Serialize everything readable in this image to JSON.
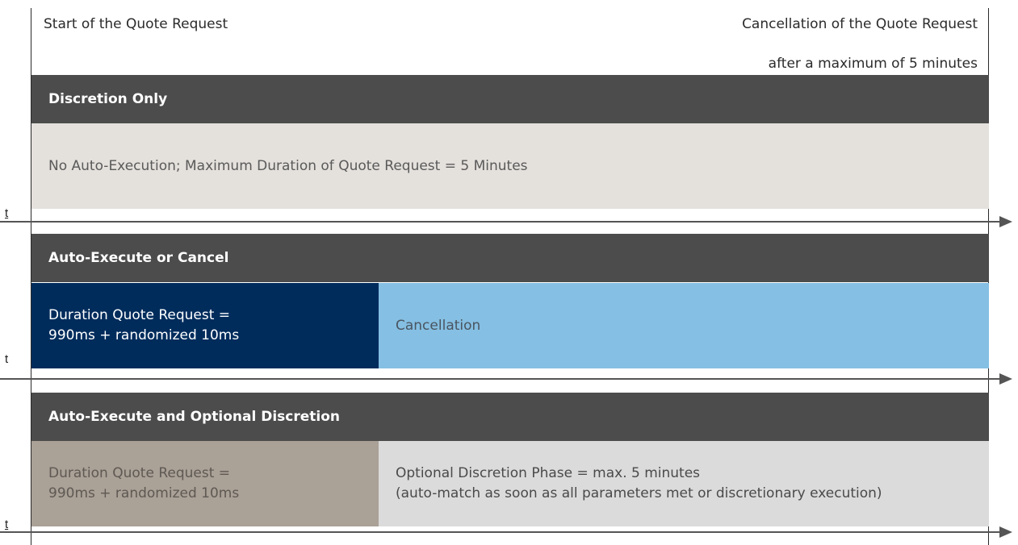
{
  "header": {
    "start_caption": "Start of the Quote Request",
    "cancel_caption": "Cancellation of the Quote Request",
    "cancel_subcaption": "after a maximum of 5 minutes"
  },
  "axis_label": "t",
  "sections": [
    {
      "title": "Discretion Only",
      "blocks": [
        {
          "lines": [
            "No Auto-Execution; Maximum Duration of Quote Request = 5 Minutes"
          ]
        }
      ]
    },
    {
      "title": "Auto-Execute or Cancel",
      "blocks": [
        {
          "lines": [
            "Duration Quote Request =",
            "990ms + randomized 10ms"
          ]
        },
        {
          "lines": [
            "Cancellation"
          ]
        }
      ]
    },
    {
      "title": "Auto-Execute and Optional Discretion",
      "blocks": [
        {
          "lines": [
            "Duration Quote Request =",
            "990ms + randomized 10ms"
          ]
        },
        {
          "lines": [
            "Optional Discretion Phase = max. 5 minutes",
            "(auto-match as soon as all parameters met or discretionary execution)"
          ]
        }
      ]
    }
  ],
  "colors": {
    "header_bar": "#4c4c4c",
    "discretion_block": "#e4e0dc",
    "auto_duration_block": "#002c5c",
    "cancellation_block": "#85bfe3",
    "optional_duration_block": "#aaa197",
    "optional_phase_block": "#dbdbdb"
  }
}
